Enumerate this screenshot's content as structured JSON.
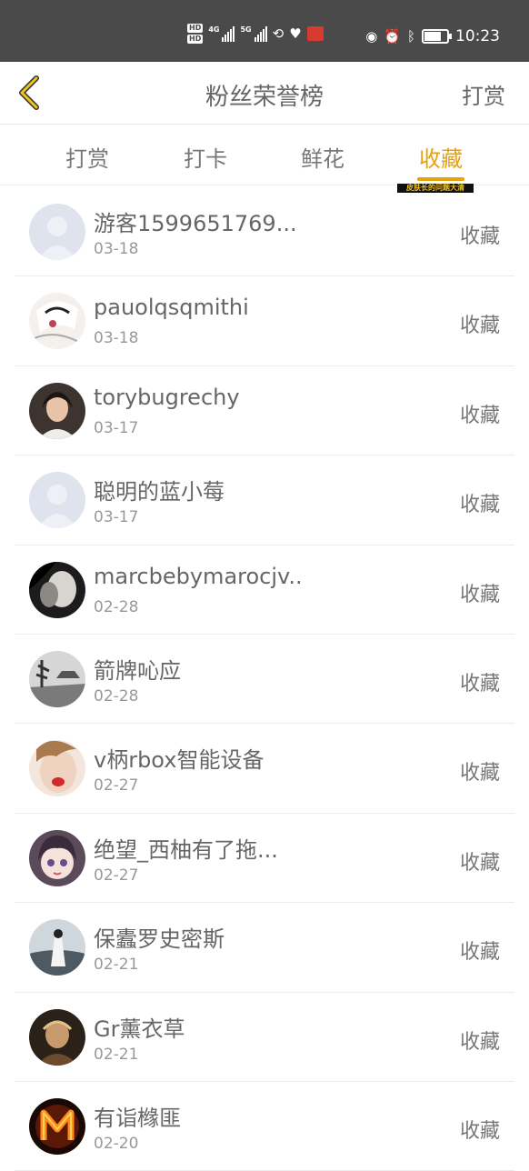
{
  "status_bar": {
    "hd1": "HD",
    "hd2": "HD",
    "signal1_label": "4G",
    "signal2_label": "5G",
    "time": "10:23"
  },
  "header": {
    "title": "粉丝荣誉榜",
    "action_label": "打赏"
  },
  "tabs": [
    {
      "label": "打赏",
      "active": false
    },
    {
      "label": "打卡",
      "active": false
    },
    {
      "label": "鲜花",
      "active": false
    },
    {
      "label": "收藏",
      "active": true
    }
  ],
  "tab_sticker": "皮肤长的问题大清",
  "colors": {
    "accent": "#e8a10a",
    "status_bar_bg": "#4a4a4a"
  },
  "list": [
    {
      "name": "游客1599651769...",
      "date": "03-18",
      "action": "收藏"
    },
    {
      "name": "pauolqsqmithi",
      "date": "03-18",
      "action": "收藏"
    },
    {
      "name": "torybugrechy",
      "date": "03-17",
      "action": "收藏"
    },
    {
      "name": "聪明的蓝小莓",
      "date": "03-17",
      "action": "收藏"
    },
    {
      "name": "marcbebymarocjv...",
      "date": "02-28",
      "action": "收藏"
    },
    {
      "name": "箭牌吣应",
      "date": "02-28",
      "action": "收藏"
    },
    {
      "name": "v柄rbox智能设备",
      "date": "02-27",
      "action": "收藏"
    },
    {
      "name": "绝望_西柚有了拖...",
      "date": "02-27",
      "action": "收藏"
    },
    {
      "name": "保蠹罗史密斯",
      "date": "02-21",
      "action": "收藏"
    },
    {
      "name": "Gr薰衣草",
      "date": "02-21",
      "action": "收藏"
    },
    {
      "name": "有诣橼匪",
      "date": "02-20",
      "action": "收藏"
    }
  ]
}
